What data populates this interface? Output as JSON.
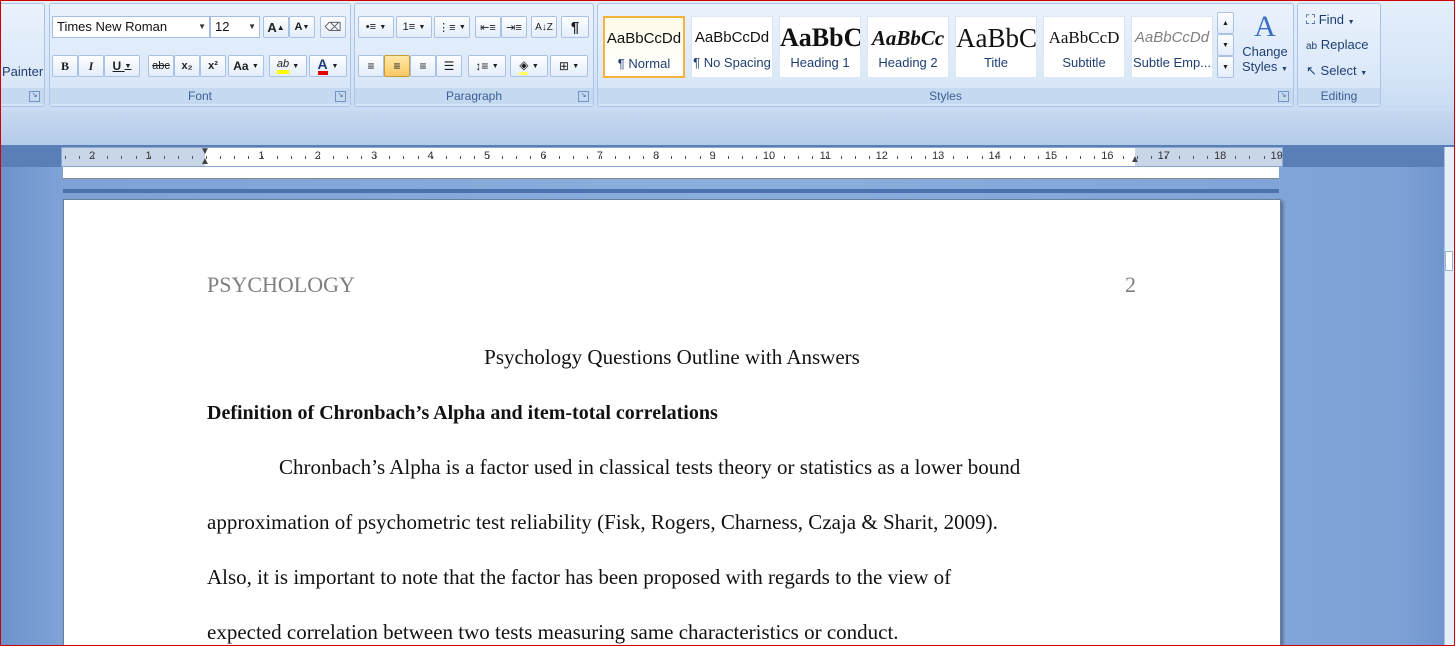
{
  "clipboard": {
    "painter_label": "Painter"
  },
  "font_group": {
    "label": "Font",
    "font_name": "Times New Roman",
    "font_size": "12",
    "grow_label": "A",
    "shrink_label": "A",
    "bold_label": "B",
    "italic_label": "I",
    "underline_label": "U",
    "strike_label": "abc",
    "subscript_label": "x₂",
    "superscript_label": "x²",
    "case_label": "Aa",
    "highlight_label": "ab",
    "fontcolor_label": "A",
    "highlight_color": "#ffff00",
    "fontcolor_color": "#e00000"
  },
  "paragraph_group": {
    "label": "Paragraph",
    "pilcrow": "¶"
  },
  "styles_group": {
    "label": "Styles",
    "items": [
      {
        "sample": "AaBbCcDd",
        "name": "¶ Normal"
      },
      {
        "sample": "AaBbCcDd",
        "name": "¶ No Spacing"
      },
      {
        "sample": "AaBbC",
        "name": "Heading 1"
      },
      {
        "sample": "AaBbCc",
        "name": "Heading 2"
      },
      {
        "sample": "AaBbC",
        "name": "Title"
      },
      {
        "sample": "AaBbCcD",
        "name": "Subtitle"
      },
      {
        "sample": "AaBbCcDd",
        "name": "Subtle Emp..."
      }
    ],
    "change_styles_line1": "Change",
    "change_styles_line2": "Styles"
  },
  "editing_group": {
    "label": "Editing",
    "find_label": "Find",
    "replace_label": "Replace",
    "select_label": "Select"
  },
  "ruler": {
    "labels": [
      "2",
      "1",
      "1",
      "2",
      "3",
      "4",
      "5",
      "6",
      "7",
      "8",
      "9",
      "10",
      "11",
      "12",
      "13",
      "14",
      "15",
      "16",
      "17",
      "18",
      "19"
    ]
  },
  "document": {
    "header_left": "PSYCHOLOGY",
    "header_right": "2",
    "title": "Psychology Questions Outline with Answers",
    "heading": "Definition of Chronbach’s Alpha and item-total correlations",
    "lines": [
      "Chronbach’s Alpha is a factor used in classical tests theory or statistics as a lower bound",
      "approximation of psychometric test reliability (Fisk, Rogers, Charness, Czaja & Sharit, 2009).",
      "Also, it is important to note that the factor has been proposed with regards to the view of",
      "expected correlation between two tests measuring same characteristics or conduct."
    ]
  }
}
